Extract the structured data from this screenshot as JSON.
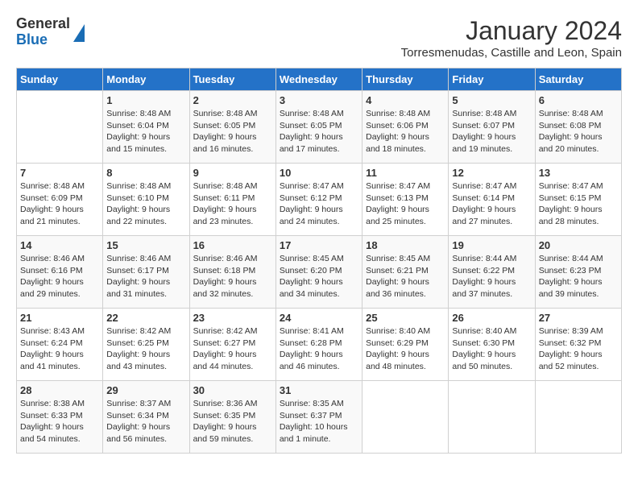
{
  "logo": {
    "general": "General",
    "blue": "Blue"
  },
  "title": "January 2024",
  "location": "Torresmenudas, Castille and Leon, Spain",
  "days_header": [
    "Sunday",
    "Monday",
    "Tuesday",
    "Wednesday",
    "Thursday",
    "Friday",
    "Saturday"
  ],
  "weeks": [
    [
      {
        "num": "",
        "sunrise": "",
        "sunset": "",
        "daylight": ""
      },
      {
        "num": "1",
        "sunrise": "Sunrise: 8:48 AM",
        "sunset": "Sunset: 6:04 PM",
        "daylight": "Daylight: 9 hours and 15 minutes."
      },
      {
        "num": "2",
        "sunrise": "Sunrise: 8:48 AM",
        "sunset": "Sunset: 6:05 PM",
        "daylight": "Daylight: 9 hours and 16 minutes."
      },
      {
        "num": "3",
        "sunrise": "Sunrise: 8:48 AM",
        "sunset": "Sunset: 6:05 PM",
        "daylight": "Daylight: 9 hours and 17 minutes."
      },
      {
        "num": "4",
        "sunrise": "Sunrise: 8:48 AM",
        "sunset": "Sunset: 6:06 PM",
        "daylight": "Daylight: 9 hours and 18 minutes."
      },
      {
        "num": "5",
        "sunrise": "Sunrise: 8:48 AM",
        "sunset": "Sunset: 6:07 PM",
        "daylight": "Daylight: 9 hours and 19 minutes."
      },
      {
        "num": "6",
        "sunrise": "Sunrise: 8:48 AM",
        "sunset": "Sunset: 6:08 PM",
        "daylight": "Daylight: 9 hours and 20 minutes."
      }
    ],
    [
      {
        "num": "7",
        "sunrise": "Sunrise: 8:48 AM",
        "sunset": "Sunset: 6:09 PM",
        "daylight": "Daylight: 9 hours and 21 minutes."
      },
      {
        "num": "8",
        "sunrise": "Sunrise: 8:48 AM",
        "sunset": "Sunset: 6:10 PM",
        "daylight": "Daylight: 9 hours and 22 minutes."
      },
      {
        "num": "9",
        "sunrise": "Sunrise: 8:48 AM",
        "sunset": "Sunset: 6:11 PM",
        "daylight": "Daylight: 9 hours and 23 minutes."
      },
      {
        "num": "10",
        "sunrise": "Sunrise: 8:47 AM",
        "sunset": "Sunset: 6:12 PM",
        "daylight": "Daylight: 9 hours and 24 minutes."
      },
      {
        "num": "11",
        "sunrise": "Sunrise: 8:47 AM",
        "sunset": "Sunset: 6:13 PM",
        "daylight": "Daylight: 9 hours and 25 minutes."
      },
      {
        "num": "12",
        "sunrise": "Sunrise: 8:47 AM",
        "sunset": "Sunset: 6:14 PM",
        "daylight": "Daylight: 9 hours and 27 minutes."
      },
      {
        "num": "13",
        "sunrise": "Sunrise: 8:47 AM",
        "sunset": "Sunset: 6:15 PM",
        "daylight": "Daylight: 9 hours and 28 minutes."
      }
    ],
    [
      {
        "num": "14",
        "sunrise": "Sunrise: 8:46 AM",
        "sunset": "Sunset: 6:16 PM",
        "daylight": "Daylight: 9 hours and 29 minutes."
      },
      {
        "num": "15",
        "sunrise": "Sunrise: 8:46 AM",
        "sunset": "Sunset: 6:17 PM",
        "daylight": "Daylight: 9 hours and 31 minutes."
      },
      {
        "num": "16",
        "sunrise": "Sunrise: 8:46 AM",
        "sunset": "Sunset: 6:18 PM",
        "daylight": "Daylight: 9 hours and 32 minutes."
      },
      {
        "num": "17",
        "sunrise": "Sunrise: 8:45 AM",
        "sunset": "Sunset: 6:20 PM",
        "daylight": "Daylight: 9 hours and 34 minutes."
      },
      {
        "num": "18",
        "sunrise": "Sunrise: 8:45 AM",
        "sunset": "Sunset: 6:21 PM",
        "daylight": "Daylight: 9 hours and 36 minutes."
      },
      {
        "num": "19",
        "sunrise": "Sunrise: 8:44 AM",
        "sunset": "Sunset: 6:22 PM",
        "daylight": "Daylight: 9 hours and 37 minutes."
      },
      {
        "num": "20",
        "sunrise": "Sunrise: 8:44 AM",
        "sunset": "Sunset: 6:23 PM",
        "daylight": "Daylight: 9 hours and 39 minutes."
      }
    ],
    [
      {
        "num": "21",
        "sunrise": "Sunrise: 8:43 AM",
        "sunset": "Sunset: 6:24 PM",
        "daylight": "Daylight: 9 hours and 41 minutes."
      },
      {
        "num": "22",
        "sunrise": "Sunrise: 8:42 AM",
        "sunset": "Sunset: 6:25 PM",
        "daylight": "Daylight: 9 hours and 43 minutes."
      },
      {
        "num": "23",
        "sunrise": "Sunrise: 8:42 AM",
        "sunset": "Sunset: 6:27 PM",
        "daylight": "Daylight: 9 hours and 44 minutes."
      },
      {
        "num": "24",
        "sunrise": "Sunrise: 8:41 AM",
        "sunset": "Sunset: 6:28 PM",
        "daylight": "Daylight: 9 hours and 46 minutes."
      },
      {
        "num": "25",
        "sunrise": "Sunrise: 8:40 AM",
        "sunset": "Sunset: 6:29 PM",
        "daylight": "Daylight: 9 hours and 48 minutes."
      },
      {
        "num": "26",
        "sunrise": "Sunrise: 8:40 AM",
        "sunset": "Sunset: 6:30 PM",
        "daylight": "Daylight: 9 hours and 50 minutes."
      },
      {
        "num": "27",
        "sunrise": "Sunrise: 8:39 AM",
        "sunset": "Sunset: 6:32 PM",
        "daylight": "Daylight: 9 hours and 52 minutes."
      }
    ],
    [
      {
        "num": "28",
        "sunrise": "Sunrise: 8:38 AM",
        "sunset": "Sunset: 6:33 PM",
        "daylight": "Daylight: 9 hours and 54 minutes."
      },
      {
        "num": "29",
        "sunrise": "Sunrise: 8:37 AM",
        "sunset": "Sunset: 6:34 PM",
        "daylight": "Daylight: 9 hours and 56 minutes."
      },
      {
        "num": "30",
        "sunrise": "Sunrise: 8:36 AM",
        "sunset": "Sunset: 6:35 PM",
        "daylight": "Daylight: 9 hours and 59 minutes."
      },
      {
        "num": "31",
        "sunrise": "Sunrise: 8:35 AM",
        "sunset": "Sunset: 6:37 PM",
        "daylight": "Daylight: 10 hours and 1 minute."
      },
      {
        "num": "",
        "sunrise": "",
        "sunset": "",
        "daylight": ""
      },
      {
        "num": "",
        "sunrise": "",
        "sunset": "",
        "daylight": ""
      },
      {
        "num": "",
        "sunrise": "",
        "sunset": "",
        "daylight": ""
      }
    ]
  ]
}
